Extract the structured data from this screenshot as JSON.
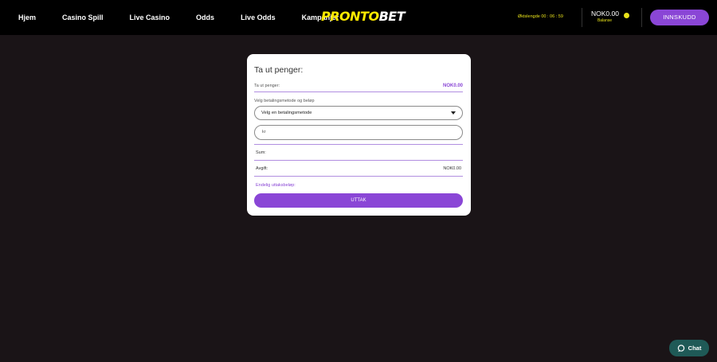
{
  "nav": {
    "items": [
      "Hjem",
      "Casino Spill",
      "Live Casino",
      "Odds",
      "Live Odds",
      "Kampanjer"
    ]
  },
  "logo": {
    "part1": "PRONTO",
    "part2": "BET"
  },
  "header": {
    "session_text": "Øktslengde 00 : 06 : 59",
    "balance_amount": "NOK0.00",
    "balance_label": "Balanse",
    "deposit_label": "INNSKUDD"
  },
  "withdraw": {
    "title": "Ta ut penger:",
    "available_label": "Ta ut penger:",
    "available_value": "NOK0.00",
    "method_label": "Velg betalingsmetode og beløp",
    "method_selected": "Velg en betalingsmetode",
    "amount_placeholder": "kr",
    "sum_label": "Sum:",
    "fee_label": "Avgift:",
    "fee_value": "NOK0.00",
    "final_label": "Endelig uttaksbeløp:",
    "submit_label": "UTTAK"
  },
  "chat": {
    "label": "Chat"
  },
  "colors": {
    "accent": "#8a46d6",
    "brand_yellow": "#ffeb00",
    "background": "#1a1417",
    "chat_bg": "#1f5a57"
  },
  "icons": [
    "chevron-down-icon",
    "coin-icon",
    "chat-bubble-icon"
  ]
}
